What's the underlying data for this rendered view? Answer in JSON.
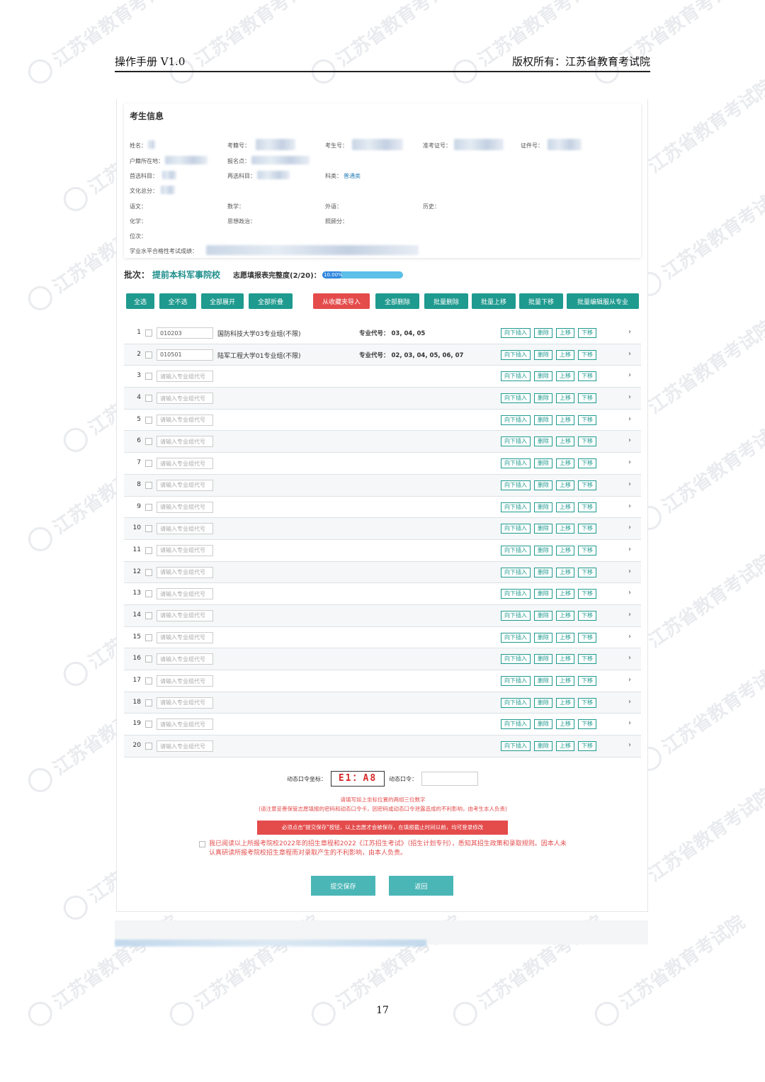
{
  "document": {
    "header_left": "操作手册 V1.0",
    "header_right": "版权所有：江苏省教育考试院",
    "page_number": "17",
    "watermark": "江苏省教育考试院"
  },
  "candidate_info": {
    "title": "考生信息",
    "labels": {
      "name": "姓名：",
      "exam_reg_no": "考籍号：",
      "candidate_no": "考生号：",
      "admission_no": "准考证号：",
      "id_no": "证件号：",
      "household_location": "户籍所在地：",
      "registration_site": "报名点：",
      "first_subject": "首选科目：",
      "second_subject": "再选科目：",
      "category": "科类：",
      "total_culture_score": "文化总分：",
      "chinese": "语文：",
      "math": "数学：",
      "foreign_language": "外语：",
      "history": "历史：",
      "chemistry": "化学：",
      "politics": "思想政治：",
      "bonus": "照顾分：",
      "rank": "位次：",
      "academic_level_exam": "学业水平合格性考试成绩："
    },
    "category_value": "普通类"
  },
  "batch": {
    "label": "批次：",
    "name": "提前本科军事院校",
    "progress_label": "志愿填报表完整度(2/20)：",
    "progress_text": "10.00%",
    "progress_fraction": 0.1
  },
  "toolbar": {
    "select_all": "全选",
    "deselect_all": "全不选",
    "expand_all": "全部展开",
    "collapse_all": "全部折叠",
    "import_favorites": "从收藏夹导入",
    "delete_all": "全部删除",
    "batch_delete": "批量删除",
    "batch_up": "批量上移",
    "batch_down": "批量下移",
    "batch_edit_adjust": "批量编辑服从专业"
  },
  "list": {
    "placeholder": "请输入专业组代号",
    "major_code_label": "专业代号：",
    "actions": {
      "insert_below": "向下插入",
      "delete": "删除",
      "move_up": "上移",
      "move_down": "下移"
    },
    "rows": [
      {
        "no": "1",
        "code": "010203",
        "school": "国防科技大学03专业组(不限)",
        "majors": "03, 04, 05"
      },
      {
        "no": "2",
        "code": "010501",
        "school": "陆军工程大学01专业组(不限)",
        "majors": "02, 03, 04, 05, 06, 07"
      },
      {
        "no": "3"
      },
      {
        "no": "4"
      },
      {
        "no": "5"
      },
      {
        "no": "6"
      },
      {
        "no": "7"
      },
      {
        "no": "8"
      },
      {
        "no": "9"
      },
      {
        "no": "10"
      },
      {
        "no": "11"
      },
      {
        "no": "12"
      },
      {
        "no": "13"
      },
      {
        "no": "14"
      },
      {
        "no": "15"
      },
      {
        "no": "16"
      },
      {
        "no": "17"
      },
      {
        "no": "18"
      },
      {
        "no": "19"
      },
      {
        "no": "20"
      }
    ]
  },
  "token": {
    "coord_label": "动态口令坐标：",
    "coord_value": "E1：A8",
    "password_label": "动态口令：",
    "hint": "请填写如上坐标位置的两组三位数字",
    "notice": "(请注意妥善保管志愿填报的密码和动态口令卡，因密码或动态口令泄露造成的不利影响，由考生本人负责)",
    "warning": "必须点击\"提交保存\"按钮，以上志愿才会被保存，在填报截止时间以前，均可登录修改",
    "agreement": "我已阅读以上所报考院校2022年的招生章程和2022《江苏招生考试》（招生计划专刊），悉知其招生政策和录取规则。因本人未认真研读所报考院校招生章程而对录取产生的不利影响，由本人负责。"
  },
  "buttons": {
    "submit": "提交保存",
    "back": "返回"
  },
  "colors": {
    "primary": "#1f9a8f",
    "danger": "#e44b4b",
    "button_light": "#4bb6b6",
    "progress": "#5cc0e8"
  }
}
